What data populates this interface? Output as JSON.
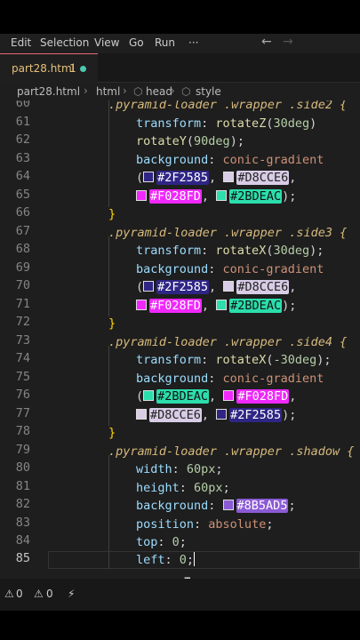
{
  "menu": {
    "items": [
      "Edit",
      "Selection",
      "View",
      "Go",
      "Run",
      "···"
    ],
    "back_icon": "arrow-left-icon",
    "forward_icon": "arrow-right-icon"
  },
  "tab": {
    "filename": "part28.html",
    "problems": "1",
    "modified_indicator": "dot"
  },
  "breadcrumb": {
    "file": "part28.html",
    "items": [
      "html",
      "head",
      "style"
    ],
    "icon_names": [
      "chevron-right-icon",
      "cube-icon"
    ]
  },
  "editor": {
    "line_numbers": [
      "60",
      "61",
      "62",
      "63",
      "64",
      "65",
      "66",
      "67",
      "68",
      "69",
      "70",
      "71",
      "72",
      "73",
      "74",
      "75",
      "76",
      "77",
      "78",
      "79",
      "80",
      "81",
      "82",
      "83",
      "84",
      "85"
    ],
    "active_line": "85",
    "selectors": {
      "side2": ".pyramid-loader .wrapper .side2 {",
      "side3": ".pyramid-loader .wrapper .side3 {",
      "side4": ".pyramid-loader .wrapper .side4 {",
      "shadow": ".pyramid-loader .wrapper .shadow {"
    },
    "tokens": {
      "transform": "transform",
      "background": "background",
      "conic": "conic-gradient",
      "rotateZ": "rotateZ",
      "rotateY": "rotateY",
      "rotateX": "rotateX",
      "deg30": "30deg",
      "deg90": "90deg",
      "degm30": "-30deg",
      "width": "width",
      "height": "height",
      "position": "position",
      "absolute": "absolute",
      "top": "top",
      "left": "left",
      "px60": "60px",
      "zero": "0",
      "close": "}"
    },
    "colors": {
      "c1": "#2F2585",
      "c2": "#D8CCE6",
      "c3": "#F028FD",
      "c4": "#2BDEAC",
      "c5": "#8B5AD5"
    }
  },
  "status": {
    "errors": "0",
    "warnings": "0"
  },
  "theme": {
    "background": "#1e1e1e",
    "selector_color": "#d7ba7d",
    "function_color": "#dcdcaa",
    "number_color": "#b5cea8",
    "property_color": "#9cdcfe"
  }
}
